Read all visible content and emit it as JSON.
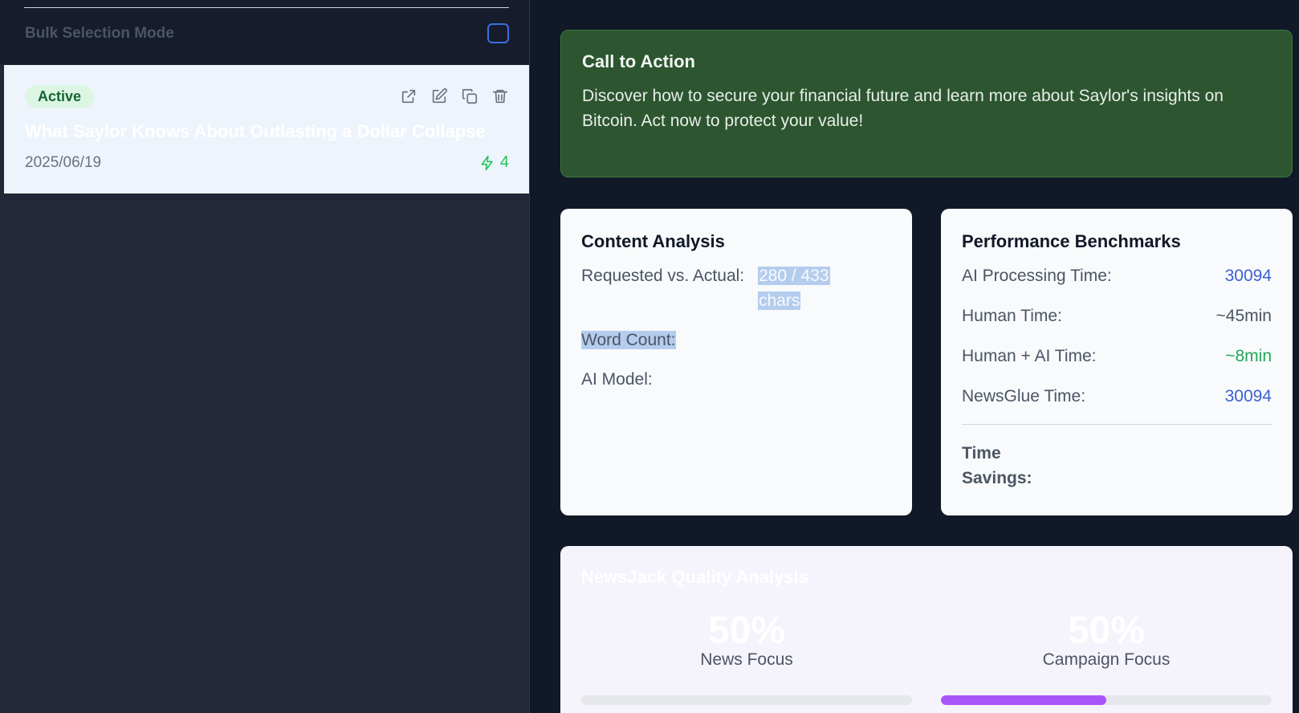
{
  "sidebar": {
    "bulk_selection_label": "Bulk Selection Mode",
    "card": {
      "status": "Active",
      "title": "What Saylor Knows About Outlasting a Dollar Collapse",
      "date": "2025/06/19",
      "count": "4",
      "actions": [
        "external-link-icon",
        "edit-icon",
        "copy-icon",
        "trash-icon"
      ]
    }
  },
  "cta": {
    "title": "Call to Action",
    "body": "Discover how to secure your financial future and learn more about Saylor's insights on Bitcoin. Act now to protect your value!"
  },
  "content_analysis": {
    "title": "Content Analysis",
    "requested_label": "Requested vs. Actual:",
    "requested_value_line1": "280 / 433",
    "requested_value_line2": "chars",
    "word_count_label": "Word Count:",
    "ai_model_label": "AI Model:"
  },
  "performance": {
    "title": "Performance Benchmarks",
    "rows": [
      {
        "label": "AI Processing Time:",
        "value": "30094"
      },
      {
        "label": "Human Time:",
        "value": "~45min"
      },
      {
        "label": "Human + AI Time:",
        "value": "~8min"
      },
      {
        "label": "NewsGlue Time:",
        "value": "30094"
      }
    ],
    "savings_label": "Time Savings:"
  },
  "quality": {
    "title": "NewsJack Quality Analysis",
    "news_focus_pct": "50%",
    "news_focus_label": "News Focus",
    "news_focus_fill": 0,
    "campaign_focus_pct": "50%",
    "campaign_focus_label": "Campaign Focus",
    "campaign_focus_fill": 0.5
  },
  "colors": {
    "accent_purple": "#a855f7",
    "cta_green": "#2c5530",
    "value_blue": "#3b5fd4",
    "value_green": "#22a75a"
  }
}
